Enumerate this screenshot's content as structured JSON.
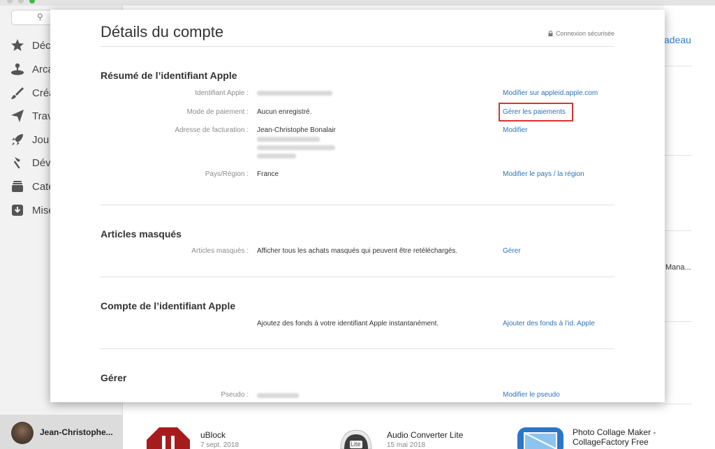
{
  "background": {
    "search_glyph": "⚲",
    "sidebar_items": [
      {
        "icon": "star-icon",
        "label": "Déc"
      },
      {
        "icon": "joystick-icon",
        "label": "Arca"
      },
      {
        "icon": "brush-icon",
        "label": "Créa"
      },
      {
        "icon": "paper-plane-icon",
        "label": "Trav"
      },
      {
        "icon": "rocket-icon",
        "label": "Jou"
      },
      {
        "icon": "hammer-icon",
        "label": "Dév"
      },
      {
        "icon": "stack-icon",
        "label": "Caté"
      },
      {
        "icon": "download-icon",
        "label": "Mise"
      }
    ],
    "user_name": "Jean-Christophe...",
    "right_link_peek": "adeau",
    "right_text_peek": "Mana...",
    "apps": [
      {
        "name": "uBlock",
        "date": "7 sept. 2018",
        "icon_color": "#a61c1c"
      },
      {
        "name": "Audio Converter Lite",
        "date": "15 mai 2018",
        "badge": "Lite",
        "icon_color": "#4a4a4a"
      },
      {
        "name": "Photo Collage Maker - CollageFactory Free",
        "date": "",
        "icon_color": "#2b76c8"
      }
    ]
  },
  "sheet": {
    "title": "Détails du compte",
    "secure_label": "Connexion sécurisée",
    "sections": {
      "summary": {
        "title": "Résumé de l’identifiant Apple",
        "apple_id_label": "Identifiant Apple :",
        "apple_id_link": "Modifier sur appleid.apple.com",
        "payment_label": "Mode de paiement :",
        "payment_value": "Aucun enregistré.",
        "payment_link": "Gérer les paiements",
        "billing_label": "Adresse de facturation :",
        "billing_name": "Jean-Christophe Bonalair",
        "billing_link": "Modifier",
        "country_label": "Pays/Région :",
        "country_value": "France",
        "country_link": "Modifier le pays / la région"
      },
      "hidden": {
        "title": "Articles masqués",
        "label": "Articles masqués :",
        "value": "Afficher tous les achats masqués qui peuvent être retéléchargés.",
        "link": "Gérer"
      },
      "account": {
        "title": "Compte de l’identifiant Apple",
        "value": "Ajoutez des fonds à votre identifiant Apple instantanément.",
        "link": "Ajouter des fonds à l’id. Apple"
      },
      "manage": {
        "title": "Gérer",
        "nickname_label": "Pseudo :",
        "nickname_link": "Modifier le pseudo"
      }
    },
    "highlight_color": "#d93434",
    "link_color": "#2f74b8"
  }
}
